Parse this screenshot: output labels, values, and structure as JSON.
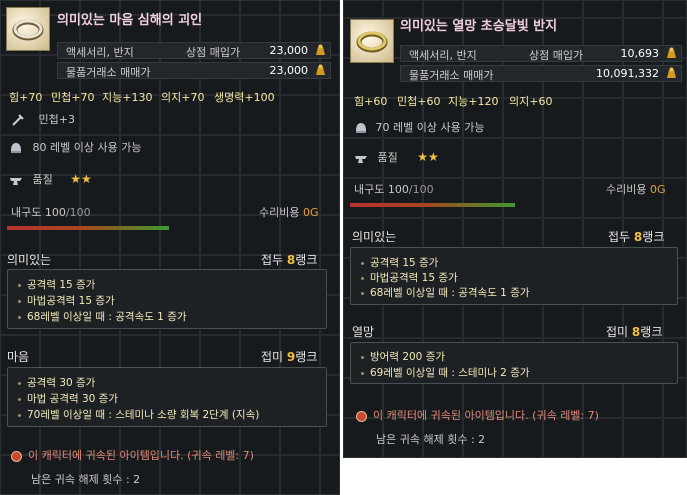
{
  "left": {
    "title": "의미있는 마음 심해의 괴인",
    "category": "액세서리, 반지",
    "shop_label": "상점 매입가",
    "shop_price": "23,000",
    "trade_label": "물품거래소 매매가",
    "trade_price": "23,000",
    "stats": [
      "힘+70",
      "민첩+70",
      "지능+130",
      "의지+70",
      "생명력+100"
    ],
    "bonus": "민첩+3",
    "level_req": "80 레벨 이상 사용 가능",
    "quality_label": "품질",
    "quality_stars": "★★",
    "durability_label": "내구도",
    "durability_value": "100",
    "durability_max": "/100",
    "repair_label": "수리비용",
    "repair_value": "0G",
    "sec1_name": "의미있는",
    "sec1_rank_label": "접두",
    "sec1_rank_num": "8",
    "sec1_rank_suffix": "랭크",
    "sec1_lines": [
      "공격력 15 증가",
      "마법공격력 15 증가",
      "68레벨 이상일 때 : 공격속도 1 증가"
    ],
    "sec2_name": "마음",
    "sec2_rank_label": "접미",
    "sec2_rank_num": "9",
    "sec2_rank_suffix": "랭크",
    "sec2_lines": [
      "공격력 30 증가",
      "마법 공격력 30 증가",
      "70레벨 이상일 때 : 스테미나 소량 회복 2단계 (지속)"
    ],
    "bound_text": "이 캐릭터에 귀속된 아이템입니다. (귀속 레벨: 7)",
    "unbind_text": "남은 귀속 해제 횟수 : 2"
  },
  "right": {
    "title": "의미있는 열망 초승달빛 반지",
    "category": "액세서리, 반지",
    "shop_label": "상점 매입가",
    "shop_price": "10,693",
    "trade_label": "물품거래소 매매가",
    "trade_price": "10,091,332",
    "stats": [
      "힘+60",
      "민첩+60",
      "지능+120",
      "의지+60"
    ],
    "level_req": "70 레벨 이상 사용 가능",
    "quality_label": "품질",
    "quality_stars": "★★",
    "durability_label": "내구도",
    "durability_value": "100",
    "durability_max": "/100",
    "repair_label": "수리비용",
    "repair_value": "0G",
    "sec1_name": "의미있는",
    "sec1_rank_label": "접두",
    "sec1_rank_num": "8",
    "sec1_rank_suffix": "랭크",
    "sec1_lines": [
      "공격력 15 증가",
      "마법공격력 15 증가",
      "68레벨 이상일 때 : 공격속도 1 증가"
    ],
    "sec2_name": "열망",
    "sec2_rank_label": "접미",
    "sec2_rank_num": "8",
    "sec2_rank_suffix": "랭크",
    "sec2_lines": [
      "방어력 200 증가",
      "69레벨 이상일 때 : 스테미나 2 증가"
    ],
    "bound_text": "이 캐릭터에 귀속된 아이템입니다. (귀속 레벨: 7)",
    "unbind_text": "남은 귀속 해제 횟수 : 2"
  },
  "colors": {
    "title": "#f1cde2",
    "stat": "#f5e7a1",
    "rank": "#f0c040",
    "bound": "#e28a74"
  }
}
